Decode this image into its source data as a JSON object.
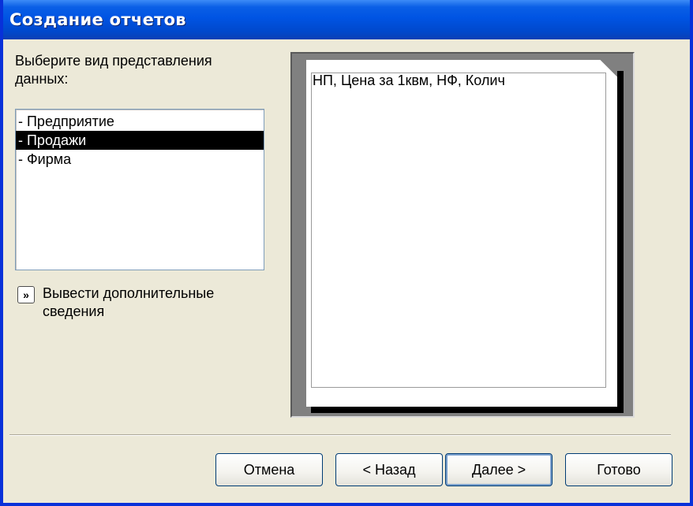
{
  "window": {
    "title": "Создание отчетов"
  },
  "left_panel": {
    "prompt": "Выберите вид представления данных:",
    "list": {
      "items": [
        {
          "label": "- Предприятие",
          "selected": false
        },
        {
          "label": "- Продажи",
          "selected": true
        },
        {
          "label": "- Фирма",
          "selected": false
        }
      ]
    },
    "more_info": {
      "button_icon": "double-chevron-right-icon",
      "label": "Вывести дополнительные сведения"
    }
  },
  "preview": {
    "fields_text": "НП, Цена за 1квм, НФ, Колич"
  },
  "buttons": {
    "cancel": "Отмена",
    "back": "< Назад",
    "next": "Далее >",
    "finish": "Готово"
  },
  "colors": {
    "titlebar": "#0054e3",
    "dialog_bg": "#ece9d8",
    "selection": "#000000"
  }
}
